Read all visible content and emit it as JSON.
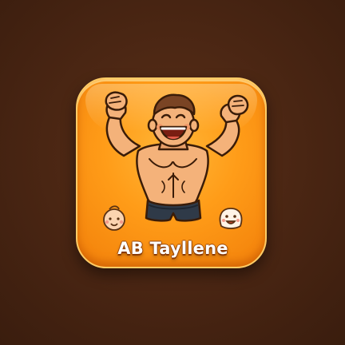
{
  "app": {
    "name": "AB Tayllene"
  },
  "colors": {
    "background": "#4a2614",
    "icon_orange": "#ff9c18",
    "icon_highlight": "#ffb637",
    "title_text": "#ffffff",
    "shorts": "#2f3a48",
    "skin": "#f4b27a"
  },
  "icons": {
    "mascot": "muscular-man-flexing-icon",
    "left_mini": "baby-face-icon",
    "right_mini": "dumpling-face-icon"
  }
}
